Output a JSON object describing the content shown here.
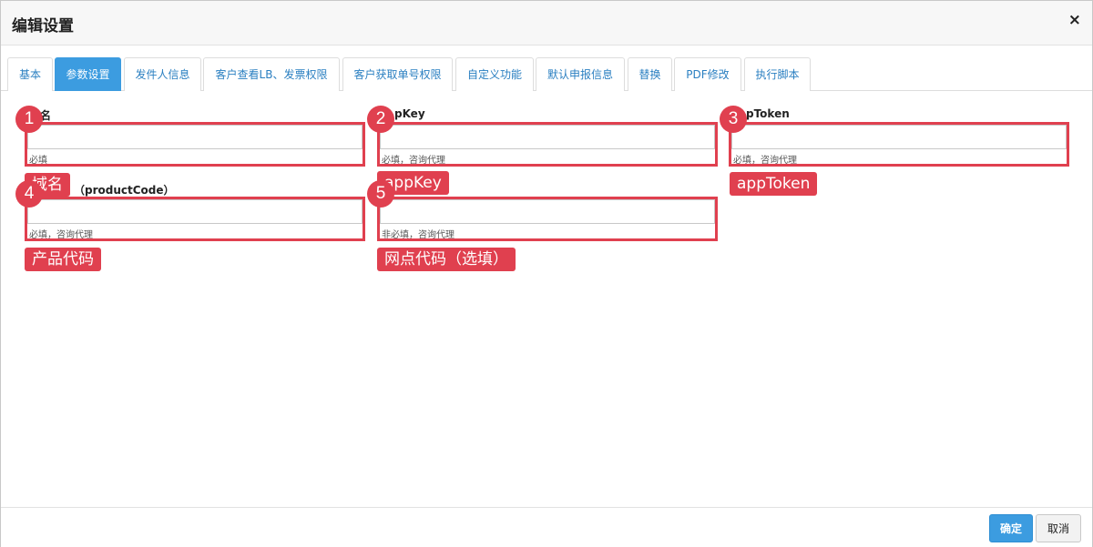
{
  "dialog": {
    "title": "编辑设置",
    "close_label": "×"
  },
  "tabs": [
    {
      "label": "基本",
      "active": false
    },
    {
      "label": "参数设置",
      "active": true
    },
    {
      "label": "发件人信息",
      "active": false
    },
    {
      "label": "客户查看LB、发票权限",
      "active": false
    },
    {
      "label": "客户获取单号权限",
      "active": false
    },
    {
      "label": "自定义功能",
      "active": false
    },
    {
      "label": "默认申报信息",
      "active": false
    },
    {
      "label": "替换",
      "active": false
    },
    {
      "label": "PDF修改",
      "active": false
    },
    {
      "label": "执行脚本",
      "active": false
    }
  ],
  "fields": [
    {
      "label": "名",
      "value": "",
      "hint": "必填",
      "badge": "1",
      "tag": "域名"
    },
    {
      "label": "pKey",
      "value": "",
      "hint": "必填，咨询代理",
      "badge": "2",
      "tag": "appKey"
    },
    {
      "label": "pToken",
      "value": "",
      "hint": "必填，咨询代理",
      "badge": "3",
      "tag": "appToken"
    },
    {
      "label": "（productCode）",
      "value": "",
      "hint": "必填，咨询代理",
      "badge": "4",
      "tag": "产品代码"
    },
    {
      "label": "",
      "value": "",
      "hint": "非必填，咨询代理",
      "badge": "5",
      "tag": "网点代码（选填）"
    }
  ],
  "footer": {
    "ok_label": "确定",
    "cancel_label": "取消"
  },
  "colors": {
    "accent": "#3c9ce0",
    "annotation": "#e0404f"
  }
}
